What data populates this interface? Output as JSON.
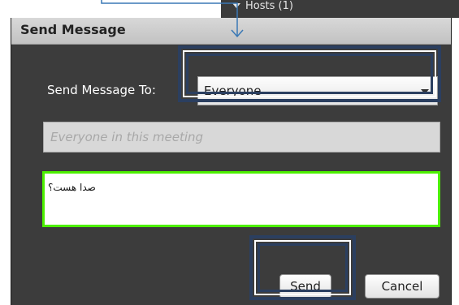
{
  "background": {
    "panel_header": "Hosts (1)"
  },
  "dialog": {
    "title": "Send Message",
    "send_to_label": "Send Message To:",
    "recipient_select": {
      "selected": "Everyone"
    },
    "recipient_description": {
      "placeholder": "Everyone in this meeting"
    },
    "message_box": {
      "value": "صدا هست؟"
    },
    "send_label": "Send",
    "cancel_label": "Cancel"
  },
  "colors": {
    "dialog_bg": "#3c3c3c",
    "focus_border": "#4cf000",
    "annotation": "#2b3f60",
    "arrow": "#3a78b5"
  },
  "icons": {
    "dropdown": "chevron-down-icon",
    "panel_toggle": "triangle-down-icon",
    "annotation_arrow": "arrow-down-icon"
  }
}
